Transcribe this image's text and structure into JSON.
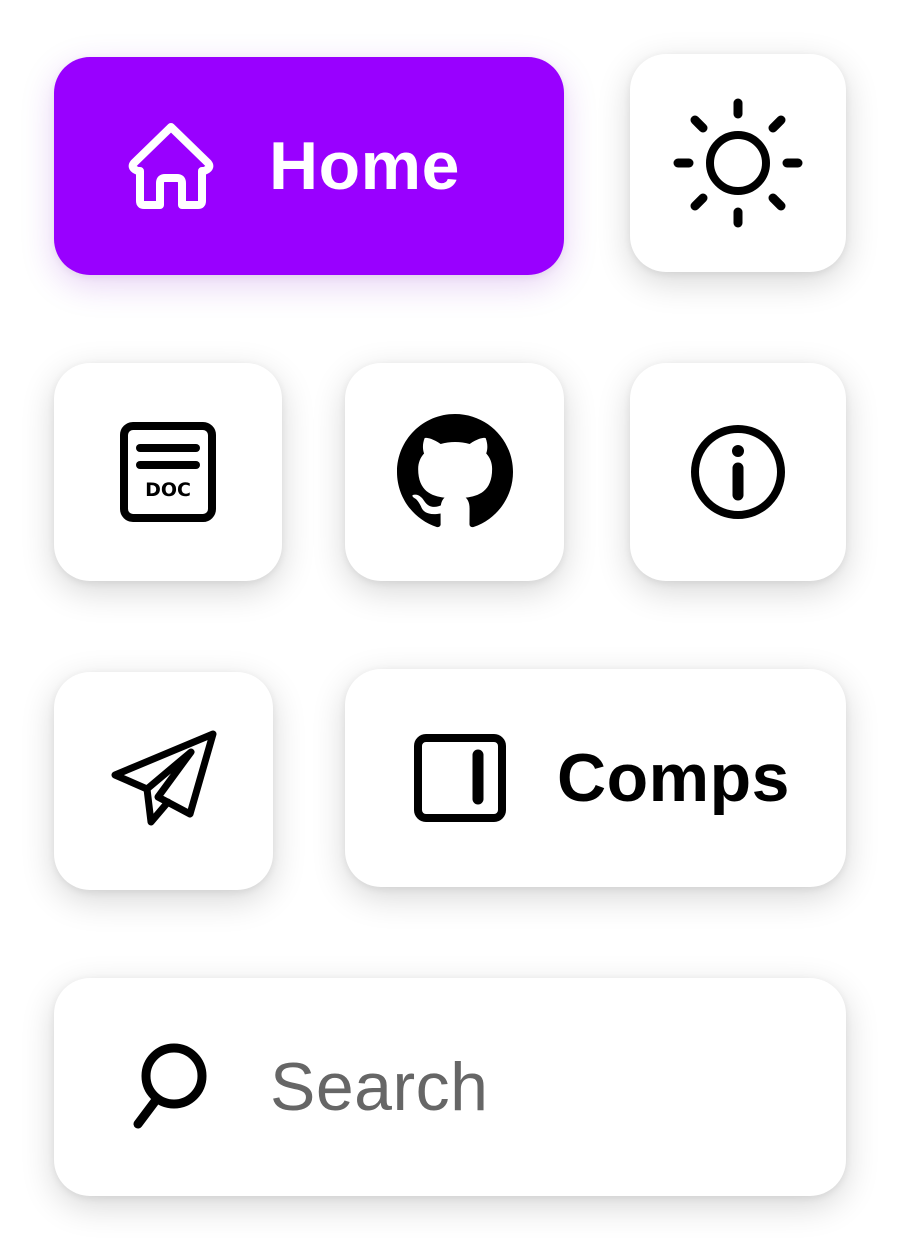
{
  "nav": {
    "home": {
      "label": "Home",
      "icon": "home-icon",
      "active": true,
      "accent_color": "#9900ff"
    },
    "theme": {
      "icon": "sun-icon"
    },
    "docs": {
      "icon": "doc-icon",
      "icon_text": "DOC"
    },
    "github": {
      "icon": "github-icon"
    },
    "info": {
      "icon": "info-icon"
    },
    "contact": {
      "icon": "paper-plane-icon"
    },
    "comps": {
      "label": "Comps",
      "icon": "sidebar-panel-icon"
    },
    "search": {
      "placeholder": "Search",
      "icon": "search-icon"
    }
  },
  "colors": {
    "accent": "#9900ff",
    "tile_background": "#ffffff",
    "icon": "#000000",
    "placeholder_text": "#666666"
  }
}
